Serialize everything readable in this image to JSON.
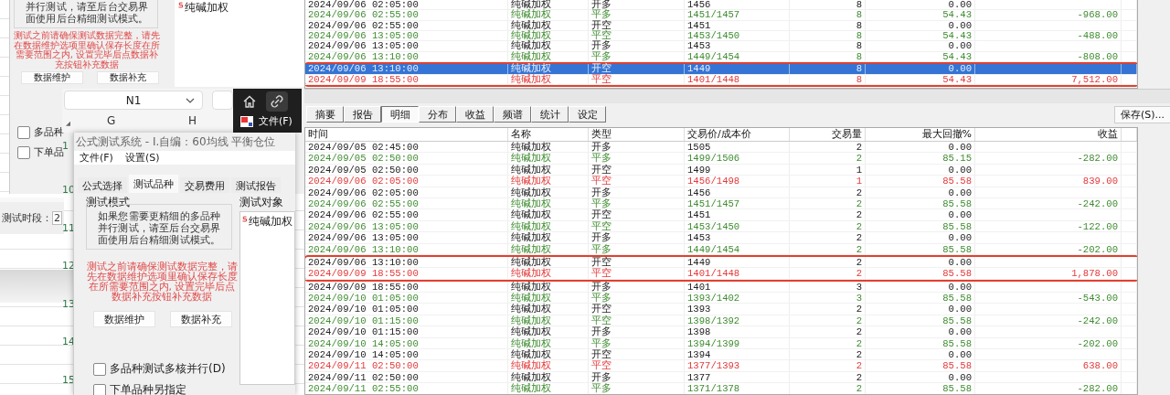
{
  "back_dialog": {
    "info_text": "并行测试，请至后台交易界面使用后台精细测试模式。",
    "warning": "测试之前请确保测试数据完整，请先在数据维护选项里确认保存长度在所需要范围之内, 设置完毕后点数据补充按钮补充数据",
    "buttons": [
      "数据维护",
      "数据补充"
    ],
    "checkboxes": [
      {
        "label": "多品种",
        "checked": false
      },
      {
        "label": "下单品",
        "checked": false
      }
    ],
    "target_items": [
      "纯碱加权"
    ],
    "period_label": "测试时段：",
    "period_value": "2"
  },
  "spreadsheet": {
    "name_box": "N1",
    "columns": [
      "G",
      "H"
    ],
    "row_numbers": [
      "1",
      "10",
      "11",
      "12",
      "13",
      "14",
      "15"
    ]
  },
  "toolbar": {
    "menu": "文件(F)"
  },
  "dialog": {
    "title": "公式测试系统 - I.自编：60均线 平衡仓位",
    "menus": [
      "文件(F)",
      "设置(S)"
    ],
    "tabs": [
      {
        "label": "公式选择",
        "selected": false
      },
      {
        "label": "测试品种",
        "selected": true
      },
      {
        "label": "交易费用",
        "selected": false
      },
      {
        "label": "测试报告",
        "selected": false
      }
    ],
    "mode_title": "测试模式",
    "mode_text": "如果您需要更精细的多品种并行测试，请至后台交易界面使用后台精细测试模式。",
    "warning": "测试之前请确保测试数据完整，请先在数据维护选项里确认保存长度在所需要范围之内, 设置完毕后点数据补充按钮补充数据",
    "buttons": [
      "数据维护",
      "数据补充"
    ],
    "checkboxes": [
      {
        "label": "多品种测试多核并行(D)",
        "checked": false
      },
      {
        "label": "下单品种另指定",
        "checked": false
      }
    ],
    "targets_title": "测试对象",
    "target_items": [
      "纯碱加权"
    ]
  },
  "report": {
    "top_rows": [
      {
        "time": "2024/09/06 02:05:00",
        "name": "纯碱加权",
        "type": "开多",
        "price": "1456",
        "qty": "8",
        "drawdown": "0.00",
        "kind": "open",
        "selected": false,
        "marked": false
      },
      {
        "time": "2024/09/06 02:55:00",
        "name": "纯碱加权",
        "type": "平多",
        "price": "1451/1457",
        "qty": "8",
        "drawdown": "54.43",
        "profit": "-968.00",
        "kind": "loss",
        "selected": false,
        "marked": false
      },
      {
        "time": "2024/09/06 02:55:00",
        "name": "纯碱加权",
        "type": "开空",
        "price": "1451",
        "qty": "8",
        "drawdown": "0.00",
        "kind": "open",
        "selected": false,
        "marked": false
      },
      {
        "time": "2024/09/06 13:05:00",
        "name": "纯碱加权",
        "type": "平空",
        "price": "1453/1450",
        "qty": "8",
        "drawdown": "54.43",
        "profit": "-488.00",
        "kind": "loss",
        "selected": false,
        "marked": false
      },
      {
        "time": "2024/09/06 13:05:00",
        "name": "纯碱加权",
        "type": "开多",
        "price": "1453",
        "qty": "8",
        "drawdown": "0.00",
        "kind": "open",
        "selected": false,
        "marked": false
      },
      {
        "time": "2024/09/06 13:10:00",
        "name": "纯碱加权",
        "type": "平多",
        "price": "1449/1454",
        "qty": "8",
        "drawdown": "54.43",
        "profit": "-808.00",
        "kind": "loss",
        "selected": false,
        "marked": false
      },
      {
        "time": "2024/09/06 13:10:00",
        "name": "纯碱加权",
        "type": "开空",
        "price": "1449",
        "qty": "8",
        "drawdown": "0.00",
        "kind": "open",
        "selected": true,
        "marked": true
      },
      {
        "time": "2024/09/09 18:55:00",
        "name": "纯碱加权",
        "type": "平空",
        "price": "1401/1448",
        "qty": "8",
        "drawdown": "54.43",
        "profit": "7,512.00",
        "kind": "gain",
        "selected": false,
        "marked": true
      }
    ],
    "tabs": [
      {
        "label": "摘要",
        "selected": false
      },
      {
        "label": "报告",
        "selected": false
      },
      {
        "label": "明细",
        "selected": true
      },
      {
        "label": "分布",
        "selected": false
      },
      {
        "label": "收益",
        "selected": false
      },
      {
        "label": "频谱",
        "selected": false
      },
      {
        "label": "统计",
        "selected": false
      },
      {
        "label": "设定",
        "selected": false
      }
    ],
    "save_button": "保存(S)...",
    "columns": [
      "时间",
      "名称",
      "类型",
      "交易价/成本价",
      "交易量",
      "最大回撤%",
      "收益"
    ],
    "rows": [
      {
        "time": "2024/09/05 02:45:00",
        "name": "纯碱加权",
        "type": "开多",
        "price": "1505",
        "qty": "2",
        "drawdown": "0.00",
        "kind": "open",
        "selected": false,
        "marked": false
      },
      {
        "time": "2024/09/05 02:50:00",
        "name": "纯碱加权",
        "type": "平多",
        "price": "1499/1506",
        "qty": "2",
        "drawdown": "85.15",
        "profit": "-282.00",
        "kind": "loss",
        "selected": false,
        "marked": false
      },
      {
        "time": "2024/09/05 02:50:00",
        "name": "纯碱加权",
        "type": "开空",
        "price": "1499",
        "qty": "1",
        "drawdown": "0.00",
        "kind": "open",
        "selected": false,
        "marked": false
      },
      {
        "time": "2024/09/06 02:05:00",
        "name": "纯碱加权",
        "type": "平空",
        "price": "1456/1498",
        "qty": "1",
        "drawdown": "85.58",
        "profit": "839.00",
        "kind": "gain",
        "selected": false,
        "marked": false
      },
      {
        "time": "2024/09/06 02:05:00",
        "name": "纯碱加权",
        "type": "开多",
        "price": "1456",
        "qty": "2",
        "drawdown": "0.00",
        "kind": "open",
        "selected": false,
        "marked": false
      },
      {
        "time": "2024/09/06 02:55:00",
        "name": "纯碱加权",
        "type": "平多",
        "price": "1451/1457",
        "qty": "2",
        "drawdown": "85.58",
        "profit": "-242.00",
        "kind": "loss",
        "selected": false,
        "marked": false
      },
      {
        "time": "2024/09/06 02:55:00",
        "name": "纯碱加权",
        "type": "开空",
        "price": "1451",
        "qty": "2",
        "drawdown": "0.00",
        "kind": "open",
        "selected": false,
        "marked": false
      },
      {
        "time": "2024/09/06 13:05:00",
        "name": "纯碱加权",
        "type": "平空",
        "price": "1453/1450",
        "qty": "2",
        "drawdown": "85.58",
        "profit": "-122.00",
        "kind": "loss",
        "selected": false,
        "marked": false
      },
      {
        "time": "2024/09/06 13:05:00",
        "name": "纯碱加权",
        "type": "开多",
        "price": "1453",
        "qty": "2",
        "drawdown": "0.00",
        "kind": "open",
        "selected": false,
        "marked": false
      },
      {
        "time": "2024/09/06 13:10:00",
        "name": "纯碱加权",
        "type": "平多",
        "price": "1449/1454",
        "qty": "2",
        "drawdown": "85.58",
        "profit": "-202.00",
        "kind": "loss",
        "selected": false,
        "marked": false
      },
      {
        "time": "2024/09/06 13:10:00",
        "name": "纯碱加权",
        "type": "开空",
        "price": "1449",
        "qty": "2",
        "drawdown": "0.00",
        "kind": "open",
        "selected": false,
        "marked": true
      },
      {
        "time": "2024/09/09 18:55:00",
        "name": "纯碱加权",
        "type": "平空",
        "price": "1401/1448",
        "qty": "2",
        "drawdown": "85.58",
        "profit": "1,878.00",
        "kind": "gain",
        "selected": false,
        "marked": true
      },
      {
        "time": "2024/09/09 18:55:00",
        "name": "纯碱加权",
        "type": "开多",
        "price": "1401",
        "qty": "3",
        "drawdown": "0.00",
        "kind": "open",
        "selected": false,
        "marked": false
      },
      {
        "time": "2024/09/10 01:05:00",
        "name": "纯碱加权",
        "type": "平多",
        "price": "1393/1402",
        "qty": "3",
        "drawdown": "85.58",
        "profit": "-543.00",
        "kind": "loss",
        "selected": false,
        "marked": false
      },
      {
        "time": "2024/09/10 01:05:00",
        "name": "纯碱加权",
        "type": "开空",
        "price": "1393",
        "qty": "2",
        "drawdown": "0.00",
        "kind": "open",
        "selected": false,
        "marked": false
      },
      {
        "time": "2024/09/10 01:15:00",
        "name": "纯碱加权",
        "type": "平空",
        "price": "1398/1392",
        "qty": "2",
        "drawdown": "85.58",
        "profit": "-242.00",
        "kind": "loss",
        "selected": false,
        "marked": false
      },
      {
        "time": "2024/09/10 01:15:00",
        "name": "纯碱加权",
        "type": "开多",
        "price": "1398",
        "qty": "2",
        "drawdown": "0.00",
        "kind": "open",
        "selected": false,
        "marked": false
      },
      {
        "time": "2024/09/10 14:05:00",
        "name": "纯碱加权",
        "type": "平多",
        "price": "1394/1399",
        "qty": "2",
        "drawdown": "85.58",
        "profit": "-202.00",
        "kind": "loss",
        "selected": false,
        "marked": false
      },
      {
        "time": "2024/09/10 14:05:00",
        "name": "纯碱加权",
        "type": "开空",
        "price": "1394",
        "qty": "2",
        "drawdown": "0.00",
        "kind": "open",
        "selected": false,
        "marked": false
      },
      {
        "time": "2024/09/11 02:50:00",
        "name": "纯碱加权",
        "type": "平空",
        "price": "1377/1393",
        "qty": "2",
        "drawdown": "85.58",
        "profit": "638.00",
        "kind": "gain",
        "selected": false,
        "marked": false
      },
      {
        "time": "2024/09/11 02:50:00",
        "name": "纯碱加权",
        "type": "开多",
        "price": "1377",
        "qty": "2",
        "drawdown": "0.00",
        "kind": "open",
        "selected": false,
        "marked": false
      },
      {
        "time": "2024/09/11 02:55:00",
        "name": "纯碱加权",
        "type": "平多",
        "price": "1371/1378",
        "qty": "2",
        "drawdown": "85.58",
        "profit": "-282.00",
        "kind": "loss",
        "selected": false,
        "marked": false
      }
    ]
  }
}
